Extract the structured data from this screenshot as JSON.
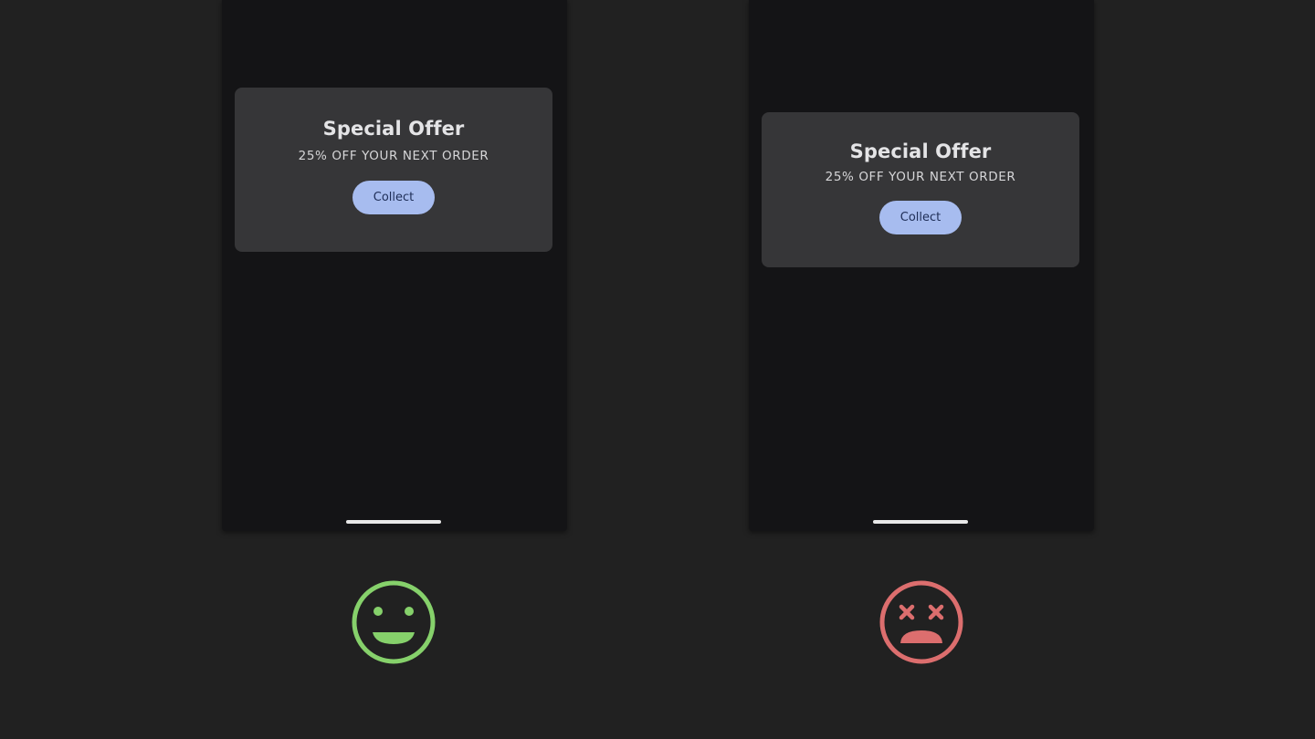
{
  "examples": [
    {
      "id": "do",
      "card": {
        "title": "Special Offer",
        "subtitle": "25% OFF YOUR NEXT ORDER",
        "button_label": "Collect"
      },
      "verdict_icon": "happy-face-icon",
      "verdict_color": "#86d16b"
    },
    {
      "id": "dont",
      "card": {
        "title": "Special Offer",
        "subtitle": "25% OFF YOUR NEXT ORDER",
        "button_label": "Collect"
      },
      "verdict_icon": "dizzy-sad-face-icon",
      "verdict_color": "#dc6e6e"
    }
  ],
  "colors": {
    "background": "#212121",
    "phone_screen": "#141416",
    "card": "#363638",
    "button": "#a7bcef",
    "button_text": "#1f2e57"
  }
}
